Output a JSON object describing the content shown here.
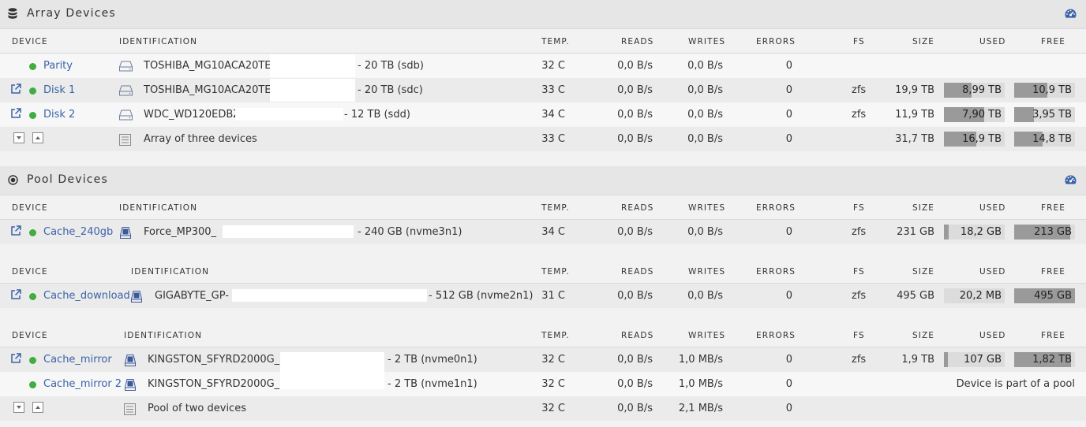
{
  "array": {
    "title": "Array Devices",
    "headers": {
      "device": "DEVICE",
      "ident": "IDENTIFICATION",
      "temp": "TEMP.",
      "reads": "READS",
      "writes": "WRITES",
      "errors": "ERRORS",
      "fs": "FS",
      "size": "SIZE",
      "used": "USED",
      "free": "FREE"
    },
    "rows": [
      {
        "device": "Parity",
        "ident": "TOSHIBA_MG10ACA20TE_",
        "ident_suffix": "- 20 TB (sdb)",
        "temp": "32 C",
        "reads": "0,0 B/s",
        "writes": "0,0 B/s",
        "errors": "0",
        "fs": "",
        "size": "",
        "used": "",
        "free": ""
      },
      {
        "device": "Disk 1",
        "ident": "TOSHIBA_MG10ACA20TE_",
        "ident_suffix": "- 20 TB (sdc)",
        "temp": "33 C",
        "reads": "0,0 B/s",
        "writes": "0,0 B/s",
        "errors": "0",
        "fs": "zfs",
        "size": "19,9 TB",
        "used": "8,99 TB",
        "free": "10,9 TB",
        "used_pct": 45,
        "free_pct": 55
      },
      {
        "device": "Disk 2",
        "ident": "WDC_WD120EDBZ-",
        "ident_suffix": "- 12 TB (sdd)",
        "temp": "34 C",
        "reads": "0,0 B/s",
        "writes": "0,0 B/s",
        "errors": "0",
        "fs": "zfs",
        "size": "11,9 TB",
        "used": "7,90 TB",
        "free": "3,95 TB",
        "used_pct": 66,
        "free_pct": 33
      }
    ],
    "summary": {
      "ident": "Array of three devices",
      "temp": "33 C",
      "reads": "0,0 B/s",
      "writes": "0,0 B/s",
      "errors": "0",
      "size": "31,7 TB",
      "used": "16,9 TB",
      "free": "14,8 TB",
      "used_pct": 53,
      "free_pct": 47
    }
  },
  "pool": {
    "title": "Pool Devices",
    "headers": {
      "device": "DEVICE",
      "ident": "IDENTIFICATION",
      "temp": "TEMP.",
      "reads": "READS",
      "writes": "WRITES",
      "errors": "ERRORS",
      "fs": "FS",
      "size": "SIZE",
      "used": "USED",
      "free": "FREE"
    },
    "cache240": {
      "device": "Cache_240gb",
      "ident": "Force_MP300_",
      "ident_suffix": "- 240 GB (nvme3n1)",
      "temp": "34 C",
      "reads": "0,0 B/s",
      "writes": "0,0 B/s",
      "errors": "0",
      "fs": "zfs",
      "size": "231 GB",
      "used": "18,2 GB",
      "free": "213 GB",
      "used_pct": 8,
      "free_pct": 92
    },
    "cachedl": {
      "device": "Cache_download",
      "ident": "GIGABYTE_GP-",
      "ident_suffix": "- 512 GB (nvme2n1)",
      "temp": "31 C",
      "reads": "0,0 B/s",
      "writes": "0,0 B/s",
      "errors": "0",
      "fs": "zfs",
      "size": "495 GB",
      "used": "20,2 MB",
      "free": "495 GB",
      "used_pct": 0,
      "free_pct": 100
    },
    "mirror1": {
      "device": "Cache_mirror",
      "ident": "KINGSTON_SFYRD2000G_",
      "ident_suffix": "- 2 TB (nvme0n1)",
      "temp": "32 C",
      "reads": "0,0 B/s",
      "writes": "1,0 MB/s",
      "errors": "0",
      "fs": "zfs",
      "size": "1,9 TB",
      "used": "107 GB",
      "free": "1,82 TB",
      "used_pct": 6,
      "free_pct": 94
    },
    "mirror2": {
      "device": "Cache_mirror 2",
      "ident": "KINGSTON_SFYRD2000G_",
      "ident_suffix": "- 2 TB (nvme1n1)",
      "temp": "32 C",
      "reads": "0,0 B/s",
      "writes": "1,0 MB/s",
      "errors": "0",
      "note": "Device is part of a pool"
    },
    "summary": {
      "ident": "Pool of two devices",
      "temp": "32 C",
      "reads": "0,0 B/s",
      "writes": "2,1 MB/s",
      "errors": "0"
    }
  }
}
